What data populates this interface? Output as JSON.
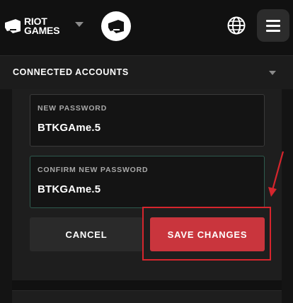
{
  "header": {
    "brand_line1": "RIOT",
    "brand_line2": "GAMES"
  },
  "icons": {
    "brand": "riot-fist-icon",
    "brand_caret": "caret-down-icon",
    "client": "riot-client-fist-icon",
    "language": "globe-icon",
    "menu": "hamburger-menu-icon",
    "section_caret": "caret-down-icon",
    "annotation": "red-arrow"
  },
  "section": {
    "title": "CONNECTED ACCOUNTS"
  },
  "form": {
    "new_password_label": "NEW PASSWORD",
    "new_password_value": "BTKGAme.5",
    "confirm_password_label": "CONFIRM NEW PASSWORD",
    "confirm_password_value": "BTKGAme.5",
    "cancel_label": "CANCEL",
    "save_label": "SAVE CHANGES"
  },
  "colors": {
    "background": "#111111",
    "panel": "#1e1e1e",
    "save_button": "#c9353d",
    "cancel_button": "#2a2a2a",
    "annotation": "#d6252d",
    "focused_border": "#2e5a4d"
  }
}
